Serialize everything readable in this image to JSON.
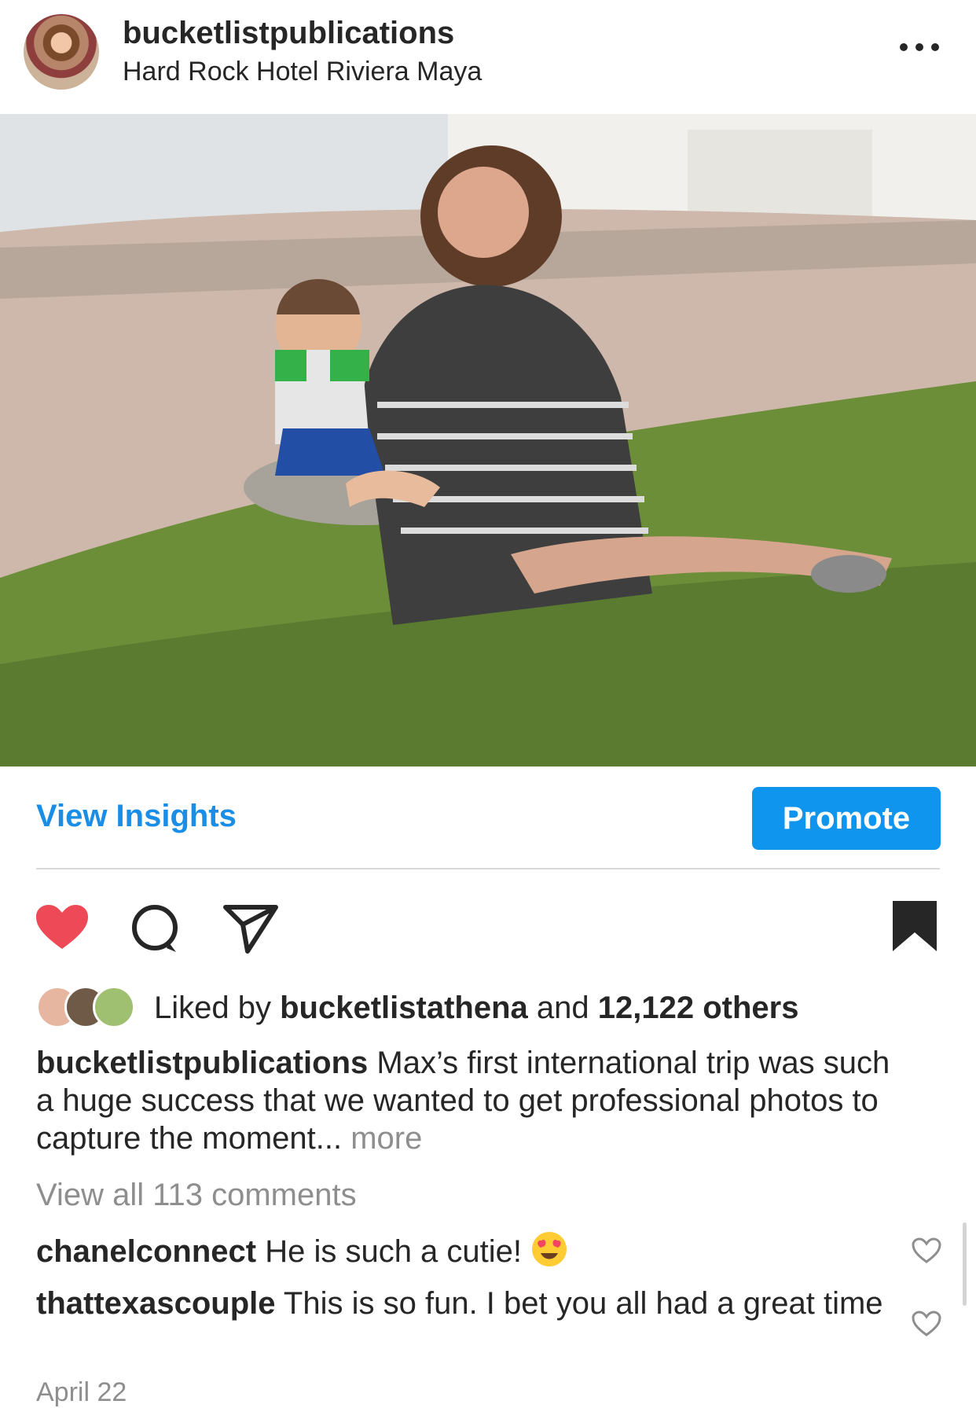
{
  "header": {
    "username": "bucketlistpublications",
    "location": "Hard Rock Hotel Riviera Maya",
    "more_icon": "ellipsis-icon"
  },
  "post": {
    "photo_icon": "photo-image"
  },
  "insights": {
    "view_label": "View Insights",
    "promote_label": "Promote",
    "accent": "#0f95ee"
  },
  "actions": {
    "like_icon": "heart-filled-icon",
    "comment_icon": "comment-icon",
    "share_icon": "share-icon",
    "save_icon": "bookmark-filled-icon",
    "like_color": "#ed4956"
  },
  "likes": {
    "prefix": "Liked by",
    "user": "bucketlistathena",
    "and": "and",
    "count": "12,122 others"
  },
  "caption": {
    "username": "bucketlistpublications",
    "text": "Max’s first international trip was such a huge success that we wanted to get professional photos to capture the moment...",
    "more": "more"
  },
  "comments": {
    "view_all": "View all 113 comments",
    "items": [
      {
        "user": "chanelconnect",
        "text": "He is such a cutie!",
        "emoji": "heart-eyes-emoji"
      },
      {
        "user": "thattexascouple",
        "text": "This is so fun. I bet you all had a great time"
      }
    ]
  },
  "date": "April 22"
}
